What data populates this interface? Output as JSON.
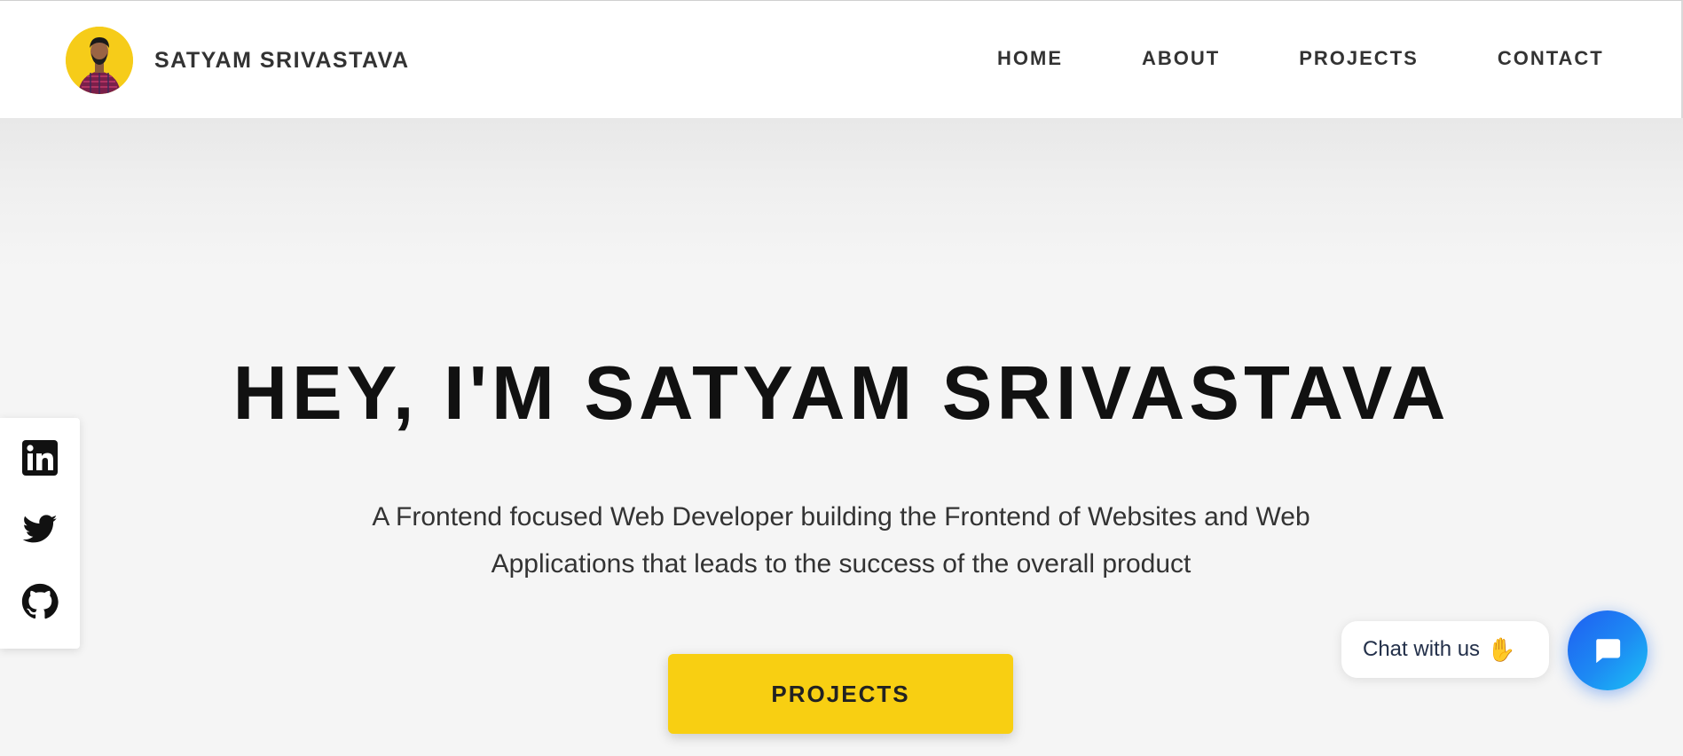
{
  "header": {
    "brand_name": "SATYAM SRIVASTAVA",
    "avatar_icon": "profile-photo",
    "nav": [
      {
        "label": "HOME"
      },
      {
        "label": "ABOUT"
      },
      {
        "label": "PROJECTS"
      },
      {
        "label": "CONTACT"
      }
    ]
  },
  "hero": {
    "title": "HEY, I'M SATYAM SRIVASTAVA",
    "subtitle": "A Frontend focused Web Developer building the Frontend of Websites and Web Applications that leads to the success of the overall product",
    "cta_label": "PROJECTS"
  },
  "social": {
    "items": [
      {
        "icon": "linkedin-icon"
      },
      {
        "icon": "twitter-icon"
      },
      {
        "icon": "github-icon"
      }
    ]
  },
  "chat": {
    "bubble_text": "Chat with us",
    "wave_icon": "waving-hand-icon",
    "button_icon": "chat-icon"
  },
  "colors": {
    "accent": "#f8cf12",
    "background": "#f5f5f5",
    "header_bg": "#ffffff",
    "text_dark": "#111111",
    "chat_blue": "#1e6ef2"
  }
}
